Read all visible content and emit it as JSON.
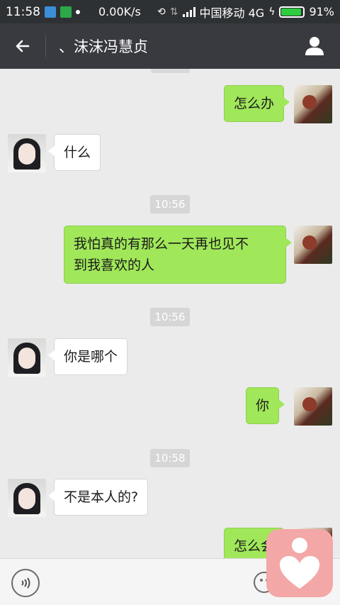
{
  "status_bar": {
    "time": "11:58",
    "speed": "0.00K/s",
    "carrier": "中国移动 4G",
    "battery": "91%",
    "battery_level": 0.91
  },
  "header": {
    "title": "、沫沫冯慧贞",
    "back_icon": "arrow-left-icon",
    "profile_icon": "person-icon"
  },
  "messages": [
    {
      "from": "me",
      "text": "怎么办"
    },
    {
      "from": "other",
      "text": "什么"
    },
    {
      "timestamp": "10:56"
    },
    {
      "from": "me",
      "text": "我怕真的有那么一天再也见不到我喜欢的人"
    },
    {
      "timestamp": "10:56"
    },
    {
      "from": "other",
      "text": "你是哪个"
    },
    {
      "from": "me",
      "text": "你"
    },
    {
      "timestamp": "10:58"
    },
    {
      "from": "other",
      "text": "不是本人的?"
    },
    {
      "from": "me",
      "text": "怎么会"
    }
  ],
  "texts": {
    "m1": "怎么办",
    "m2": "什么",
    "t1": "10:56",
    "m3a": "我怕真的有那么一天再也见不",
    "m3b": "到我喜欢的人",
    "t2": "10:56",
    "m4": "你是哪个",
    "m5": "你",
    "t3": "10:58",
    "m6": "不是本人的?",
    "m7": "怎么会"
  },
  "colors": {
    "header_bg": "#393a3f",
    "chat_bg": "#ebebeb",
    "my_bubble": "#a0e75a",
    "their_bubble": "#ffffff",
    "overlay_app": "#f4a7a7"
  }
}
